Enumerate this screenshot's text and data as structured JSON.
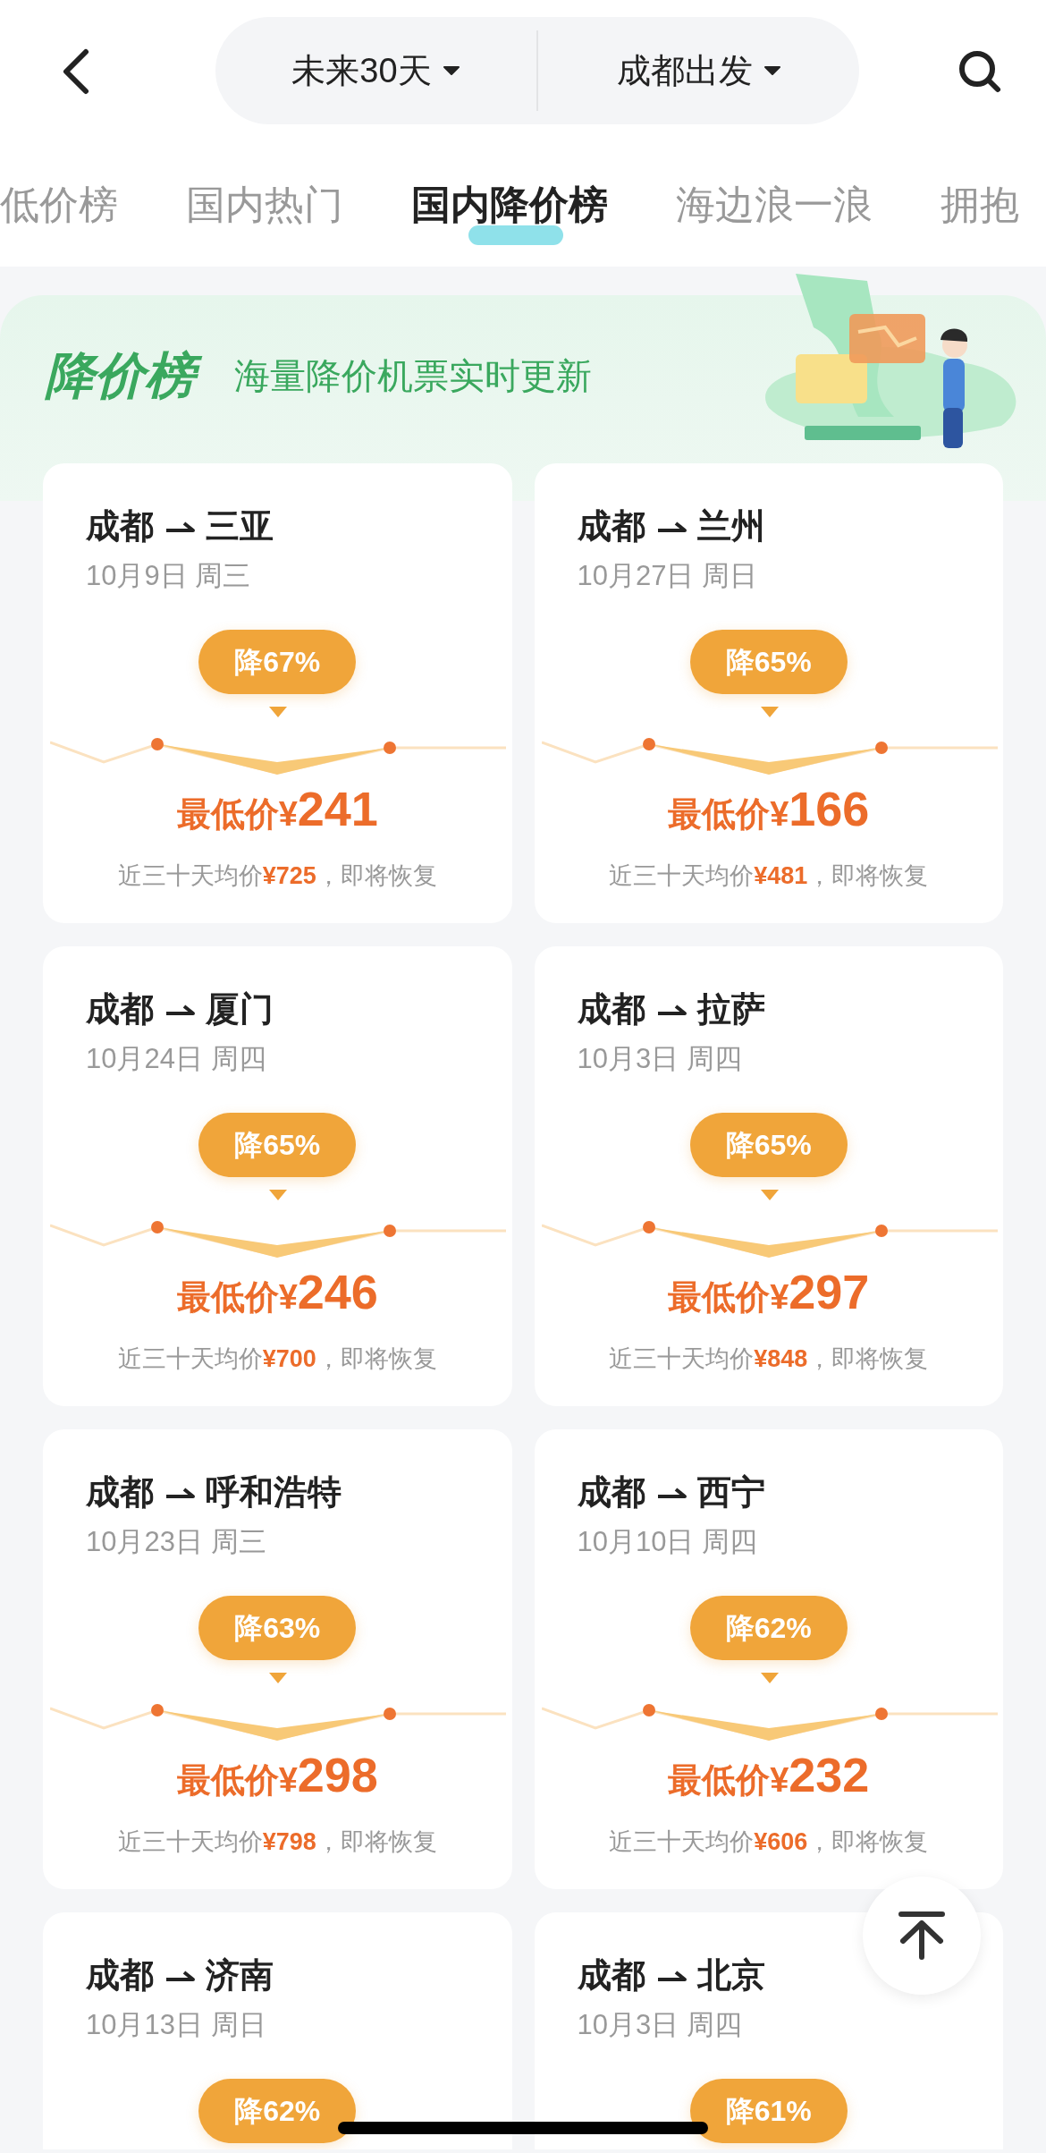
{
  "header": {
    "date_range": "未来30天",
    "departure": "成都出发"
  },
  "tabs": [
    {
      "label": "低价榜",
      "selected": false
    },
    {
      "label": "国内热门",
      "selected": false
    },
    {
      "label": "国内降价榜",
      "selected": true
    },
    {
      "label": "海边浪一浪",
      "selected": false
    },
    {
      "label": "拥抱",
      "selected": false
    }
  ],
  "banner": {
    "title": "降价榜",
    "subtitle": "海量降价机票实时更新"
  },
  "cards": [
    {
      "from": "成都",
      "to": "三亚",
      "date": "10月9日 周三",
      "discount": "降67%",
      "price_label": "最低价¥",
      "price": "241",
      "average": "近三十天均价**¥725**，即将恢复"
    },
    {
      "from": "成都",
      "to": "兰州",
      "date": "10月27日 周日",
      "discount": "降65%",
      "price_label": "最低价¥",
      "price": "166",
      "average": "近三十天均价**¥481**，即将恢复"
    },
    {
      "from": "成都",
      "to": "厦门",
      "date": "10月24日 周四",
      "discount": "降65%",
      "price_label": "最低价¥",
      "price": "246",
      "average": "近三十天均价**¥700**，即将恢复"
    },
    {
      "from": "成都",
      "to": "拉萨",
      "date": "10月3日 周四",
      "discount": "降65%",
      "price_label": "最低价¥",
      "price": "297",
      "average": "近三十天均价**¥848**，即将恢复"
    },
    {
      "from": "成都",
      "to": "呼和浩特",
      "date": "10月23日 周三",
      "discount": "降63%",
      "price_label": "最低价¥",
      "price": "298",
      "average": "近三十天均价**¥798**，即将恢复"
    },
    {
      "from": "成都",
      "to": "西宁",
      "date": "10月10日 周四",
      "discount": "降62%",
      "price_label": "最低价¥",
      "price": "232",
      "average": "近三十天均价**¥606**，即将恢复"
    },
    {
      "from": "成都",
      "to": "济南",
      "date": "10月13日 周日",
      "discount": "降62%"
    },
    {
      "from": "成都",
      "to": "北京",
      "date": "10月3日 周四",
      "discount": "降61%"
    }
  ]
}
